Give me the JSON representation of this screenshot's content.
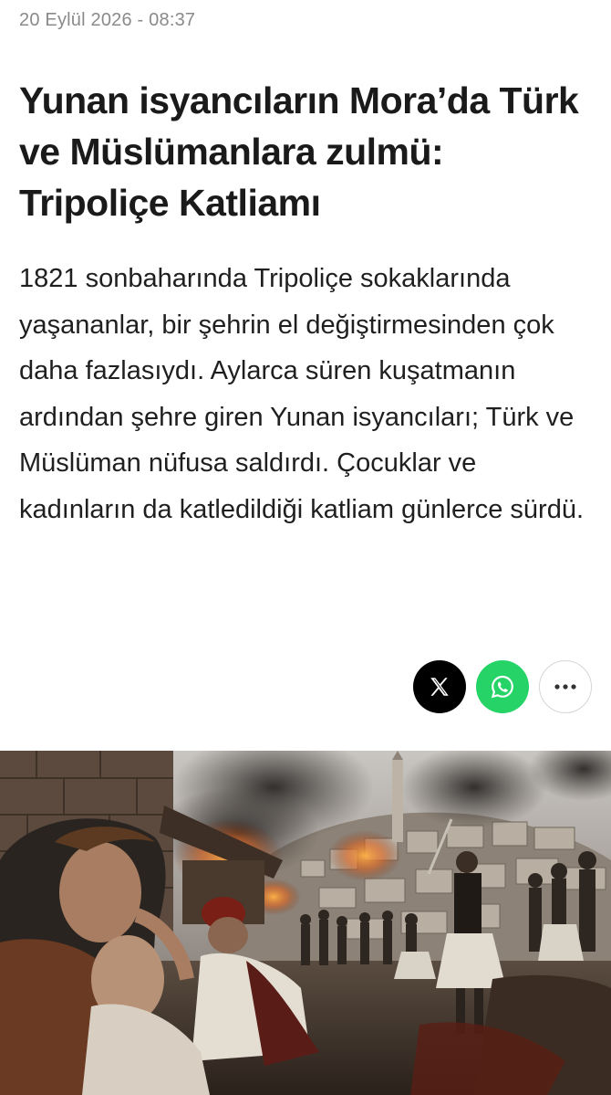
{
  "article": {
    "date": "20 Eylül 2026 - 08:37",
    "headline": "Yunan isyancıların Mora’da Türk ve Müslümanlara zulmü: Tripoliçe Katliamı",
    "summary": "1821 sonbaharında Tripoliçe sokaklarında yaşananlar, bir şehrin el değiştirmesinden çok daha fazlasıydı. Aylarca süren kuşatmanın ardından şehre giren Yunan isyancıları; Türk ve Müslüman nüfusa saldırdı. Çocuklar ve kadınların da katledildiği katliam günlerce sürdü."
  },
  "share": {
    "buttons": [
      {
        "icon": "x-logo-icon",
        "color": "#000000"
      },
      {
        "icon": "whatsapp-icon",
        "color": "#25d366"
      },
      {
        "icon": "more-icon",
        "color": "#ffffff"
      }
    ]
  },
  "hero_image": {
    "subject": "painting of a burning hillside town with fleeing women and children and armed rebels"
  }
}
